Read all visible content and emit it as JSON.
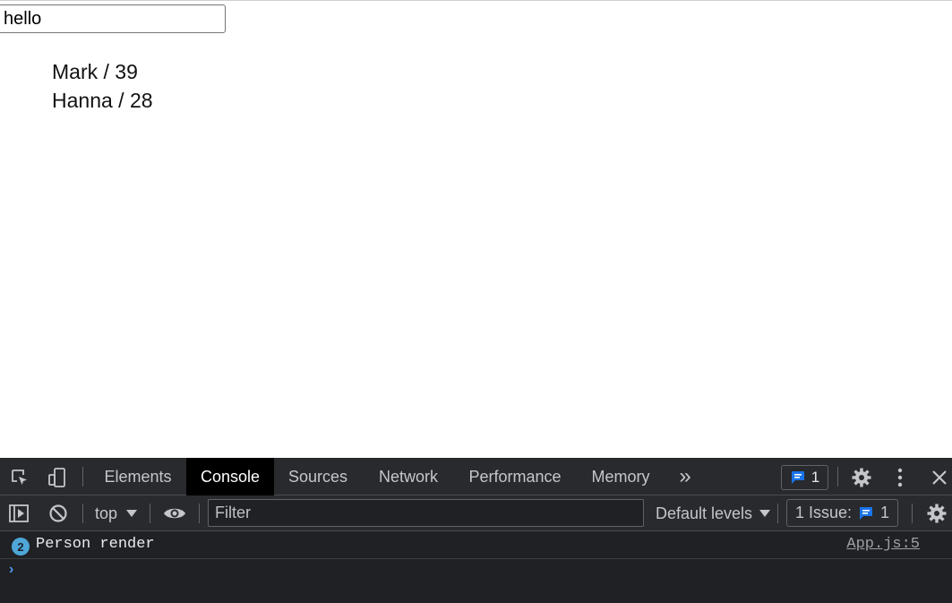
{
  "page": {
    "input_value": "hello",
    "people": [
      "Mark / 39",
      "Hanna / 28"
    ]
  },
  "devtools": {
    "tabs": [
      "Elements",
      "Console",
      "Sources",
      "Network",
      "Performance",
      "Memory"
    ],
    "active_tab": "Console",
    "more_tabs_glyph": "»",
    "messages_badge": "1",
    "toolbar": {
      "context": "top",
      "filter_placeholder": "Filter",
      "levels": "Default levels",
      "issues_label": "1 Issue:",
      "issues_count": "1"
    },
    "console": {
      "count": "2",
      "message": "Person render",
      "source": "App.js:5"
    },
    "prompt_glyph": "›"
  },
  "colors": {
    "devtools_bg": "#202124",
    "tabbar_bg": "#292a2d",
    "accent_blue": "#1a73e8",
    "count_badge": "#4ea6d9"
  },
  "icons": [
    "inspect-element-icon",
    "device-toolbar-icon",
    "chevron-double-right-icon",
    "message-icon",
    "gear-icon",
    "kebab-menu-icon",
    "close-icon",
    "sidebar-toggle-icon",
    "clear-console-icon",
    "dropdown-arrow-icon",
    "eye-icon",
    "issue-icon",
    "prompt-chevron-icon"
  ]
}
